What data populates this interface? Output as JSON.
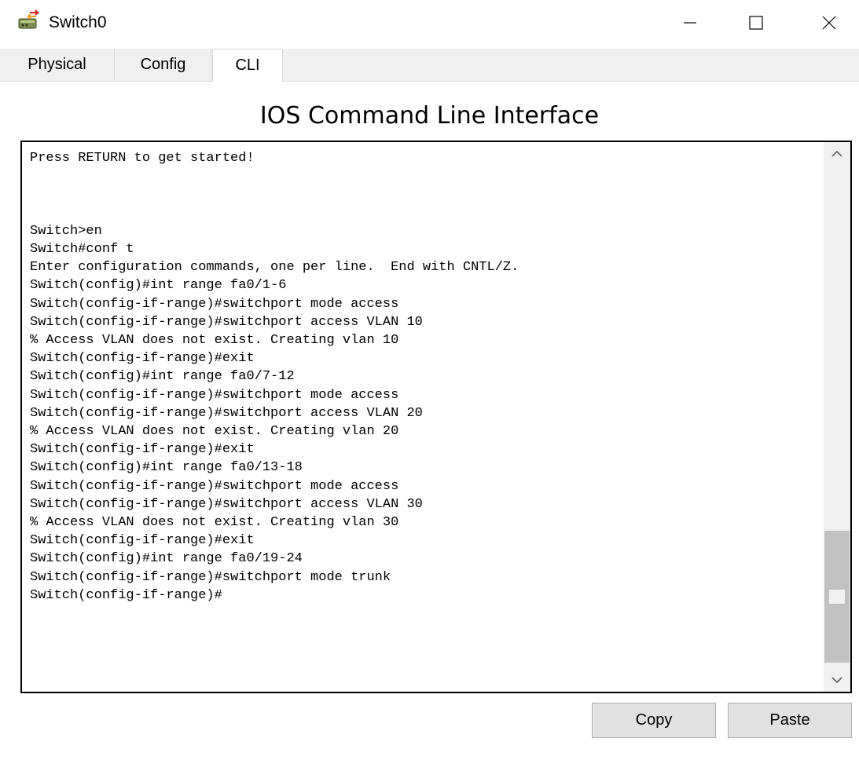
{
  "window": {
    "title": "Switch0",
    "icon": "switch-device-icon",
    "controls": [
      "minimize-icon",
      "maximize-icon",
      "close-icon"
    ]
  },
  "tabs": [
    {
      "label": "Physical",
      "active": false
    },
    {
      "label": "Config",
      "active": false
    },
    {
      "label": "CLI",
      "active": true
    }
  ],
  "cli": {
    "heading": "IOS Command Line Interface",
    "output": "Press RETURN to get started!\n\n\n\nSwitch>en\nSwitch#conf t\nEnter configuration commands, one per line.  End with CNTL/Z.\nSwitch(config)#int range fa0/1-6\nSwitch(config-if-range)#switchport mode access\nSwitch(config-if-range)#switchport access VLAN 10\n% Access VLAN does not exist. Creating vlan 10\nSwitch(config-if-range)#exit\nSwitch(config)#int range fa0/7-12\nSwitch(config-if-range)#switchport mode access\nSwitch(config-if-range)#switchport access VLAN 20\n% Access VLAN does not exist. Creating vlan 20\nSwitch(config-if-range)#exit\nSwitch(config)#int range fa0/13-18\nSwitch(config-if-range)#switchport mode access\nSwitch(config-if-range)#switchport access VLAN 30\n% Access VLAN does not exist. Creating vlan 30\nSwitch(config-if-range)#exit\nSwitch(config)#int range fa0/19-24\nSwitch(config-if-range)#switchport mode trunk\nSwitch(config-if-range)#"
  },
  "buttons": {
    "copy": "Copy",
    "paste": "Paste"
  }
}
